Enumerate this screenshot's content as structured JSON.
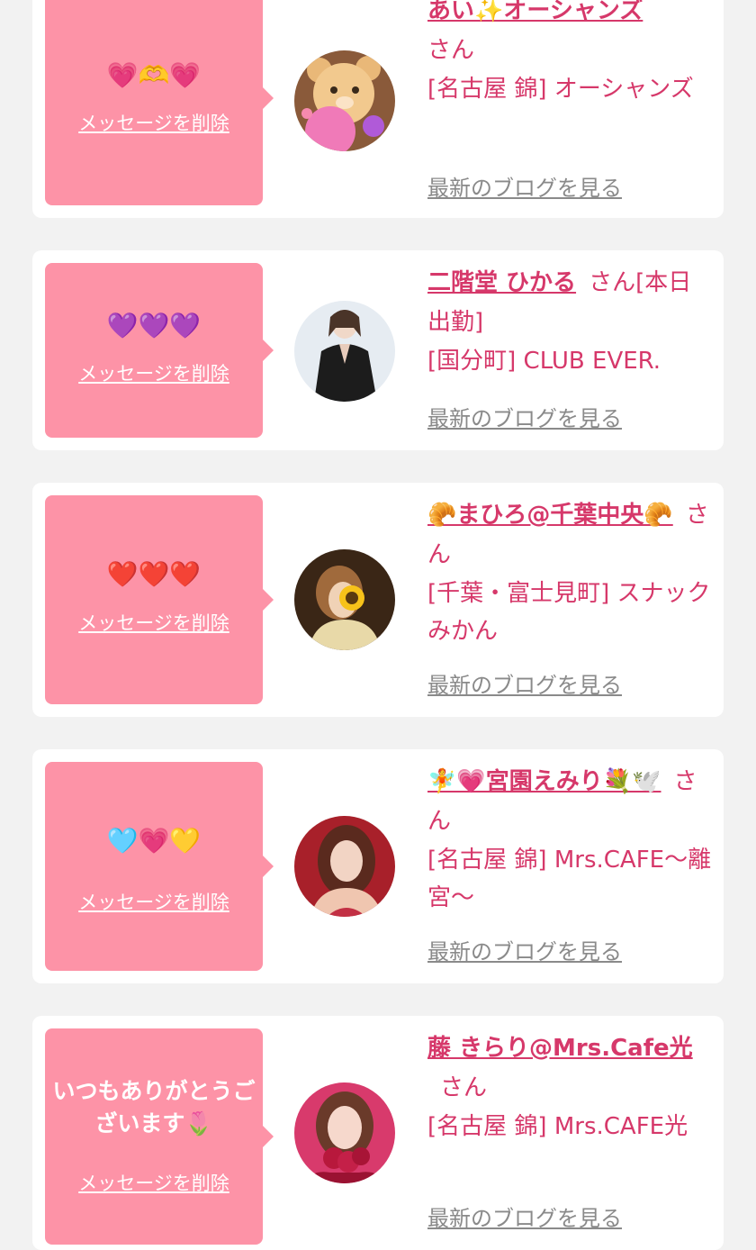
{
  "colors": {
    "background": "#f2f2f2",
    "card": "#ffffff",
    "bubble": "#fd93a7",
    "accent_text": "#d6386a",
    "link_gray": "#8a8a8a"
  },
  "common": {
    "delete_label": "メッセージを削除",
    "blog_label": "最新のブログを見る",
    "honorific": "さん"
  },
  "cards": [
    {
      "message": "💗🫶💗",
      "name": "あい✨オーシャンズ",
      "status": "",
      "shop": "[名古屋 錦] オーシャンズ",
      "avatar_icon": "teddy-bear-avatar"
    },
    {
      "message": "💜💜💜",
      "name": "二階堂 ひかる",
      "status": "[本日出勤]",
      "shop": "[国分町] CLUB EVER.",
      "avatar_icon": "woman-black-dress-avatar"
    },
    {
      "message": "❤️❤️❤️",
      "name": "🥐まひろ@千葉中央🥐",
      "status": "",
      "shop": "[千葉・富士見町] スナックみかん",
      "avatar_icon": "woman-sunflower-avatar"
    },
    {
      "message": "🩵💗💛",
      "name": "🧚💗宮園えみり💐🕊️",
      "status": "",
      "shop": "[名古屋 錦] Mrs.CAFE〜離宮〜",
      "avatar_icon": "woman-red-background-avatar"
    },
    {
      "message": "いつもありがとうございます🌷",
      "name": "藤 きらり@Mrs.Cafe光",
      "status": "",
      "shop": "[名古屋 錦] Mrs.CAFE光",
      "avatar_icon": "woman-pink-roses-avatar"
    }
  ]
}
